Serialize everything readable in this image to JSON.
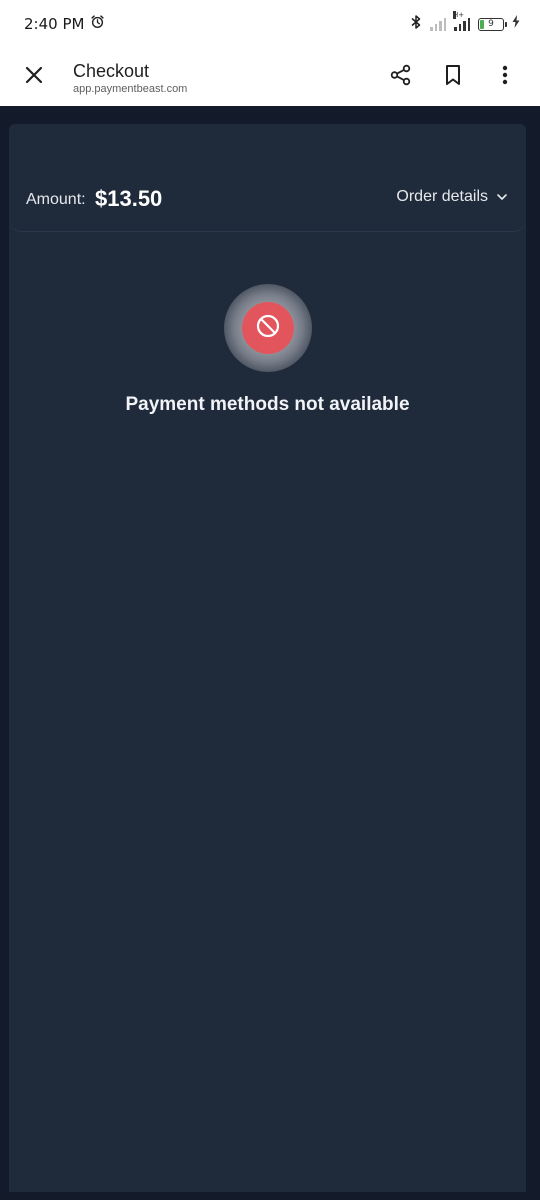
{
  "status_bar": {
    "time": "2:40 PM",
    "network_label": "H+",
    "battery_level": "9",
    "icons": [
      "alarm-icon",
      "bluetooth-icon",
      "signal-icon",
      "battery-icon",
      "charging-icon"
    ]
  },
  "toolbar": {
    "title": "Checkout",
    "url": "app.paymentbeast.com",
    "icons": [
      "close-icon",
      "share-icon",
      "bookmark-icon",
      "more-vertical-icon"
    ]
  },
  "checkout": {
    "amount_label": "Amount:",
    "amount_value": "$13.50",
    "order_details_label": "Order details",
    "error_message": "Payment methods not available",
    "icons": [
      "chevron-down-icon",
      "blocked-icon"
    ]
  },
  "colors": {
    "background": "#131a2a",
    "panel": "#1f2a3b",
    "error_red": "#e2555d",
    "toolbar": "#ffffff"
  }
}
